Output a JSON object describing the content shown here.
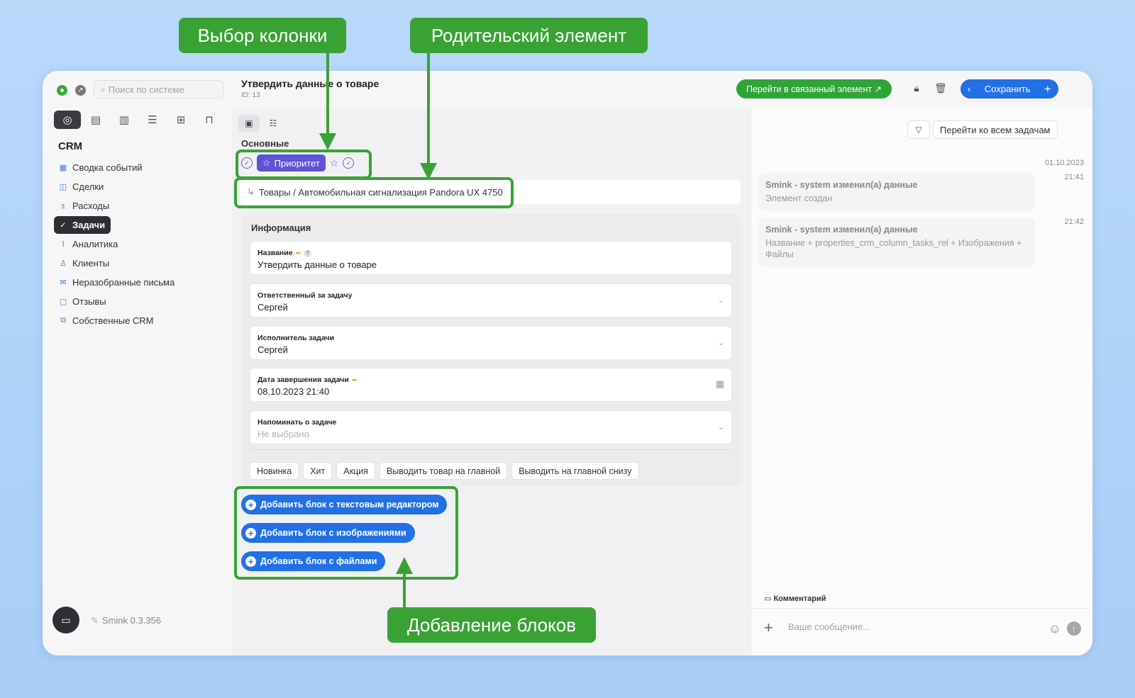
{
  "sidebar": {
    "search_placeholder": "Поиск по системе",
    "section_title": "CRM",
    "items": [
      {
        "label": "Сводка событий",
        "icon": "grid-icon"
      },
      {
        "label": "Сделки",
        "icon": "board-icon"
      },
      {
        "label": "Расходы",
        "icon": "plus-minus-icon"
      },
      {
        "label": "Задачи",
        "icon": "check-circle-icon",
        "active": true
      },
      {
        "label": "Аналитика",
        "icon": "chart-line-icon"
      },
      {
        "label": "Клиенты",
        "icon": "user-icon"
      },
      {
        "label": "Неразобранные письма",
        "icon": "mail-icon"
      },
      {
        "label": "Отзывы",
        "icon": "message-icon"
      },
      {
        "label": "Собственные CRM",
        "icon": "copy-icon"
      }
    ],
    "version": "Smink 0.3.356"
  },
  "header": {
    "title": "Утвердить данные о товаре",
    "id_label": "ID: 13",
    "related_button": "Перейти в связанный элемент ↗",
    "save_button": "Сохранить"
  },
  "main": {
    "section_basic": "Основные",
    "priority_tag": "Приоритет",
    "parent_path": "Товары / Автомобильная сигнализация Pandora UX 4750",
    "info": {
      "title": "Информация",
      "fields": [
        {
          "label": "Название",
          "value": "Утвердить данные о товаре",
          "required": true,
          "help": true
        },
        {
          "label": "Ответственный за задачу",
          "value": "Сергей",
          "control": "select"
        },
        {
          "label": "Исполнитель задачи",
          "value": "Сергей",
          "control": "select"
        },
        {
          "label": "Дата завершения задачи",
          "value": "08.10.2023 21:40",
          "required": true,
          "control": "date"
        },
        {
          "label": "Напоминать о задаче",
          "value": "Не выбрано",
          "control": "select",
          "placeholder": true
        }
      ],
      "chips": [
        "Новинка",
        "Хит",
        "Акция",
        "Выводить товар на главной",
        "Выводить на главной снизу"
      ]
    },
    "add_buttons": [
      "Добавить блок с текстовым редактором",
      "Добавить блок с изображениями",
      "Добавить блок с файлами"
    ]
  },
  "right_panel": {
    "all_tasks_button": "Перейти ко всем задачам",
    "date": "01.10.2023",
    "log": [
      {
        "title": "Smink - system изменил(а) данные",
        "detail": "Элемент создан",
        "time": "21:41"
      },
      {
        "title": "Smink - system изменил(а) данные",
        "detail": "Название + properties_crm_column_tasks_rel + Изображения + Файлы",
        "time": "21:42"
      }
    ],
    "comment_label": "Комментарий",
    "message_placeholder": "Ваше сообщение..."
  },
  "annotations": {
    "column_choice": "Выбор колонки",
    "parent_element": "Родительский элемент",
    "add_blocks": "Добавление блоков",
    "color": "#3aa235"
  }
}
